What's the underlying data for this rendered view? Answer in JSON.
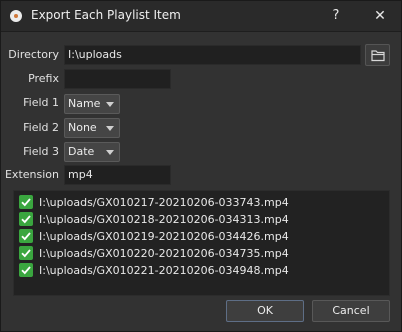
{
  "window": {
    "title": "Export Each Playlist Item",
    "help_label": "?",
    "close_label": "✕"
  },
  "form": {
    "directory_label": "Directory",
    "directory_value": "I:\\uploads",
    "prefix_label": "Prefix",
    "prefix_value": "",
    "field1_label": "Field 1",
    "field1_value": "Name",
    "field2_label": "Field 2",
    "field2_value": "None",
    "field3_label": "Field 3",
    "field3_value": "Date",
    "extension_label": "Extension",
    "extension_value": "mp4"
  },
  "items": [
    "I:\\uploads/GX010217-20210206-033743.mp4",
    "I:\\uploads/GX010218-20210206-034313.mp4",
    "I:\\uploads/GX010219-20210206-034426.mp4",
    "I:\\uploads/GX010220-20210206-034735.mp4",
    "I:\\uploads/GX010221-20210206-034948.mp4"
  ],
  "buttons": {
    "ok_label": "OK",
    "cancel_label": "Cancel"
  },
  "icons": {
    "app": "app-logo-icon",
    "browse": "folder-icon",
    "check": "checkmark-icon"
  },
  "colors": {
    "check_green": "#3aa63f",
    "window_bg": "#323232"
  }
}
